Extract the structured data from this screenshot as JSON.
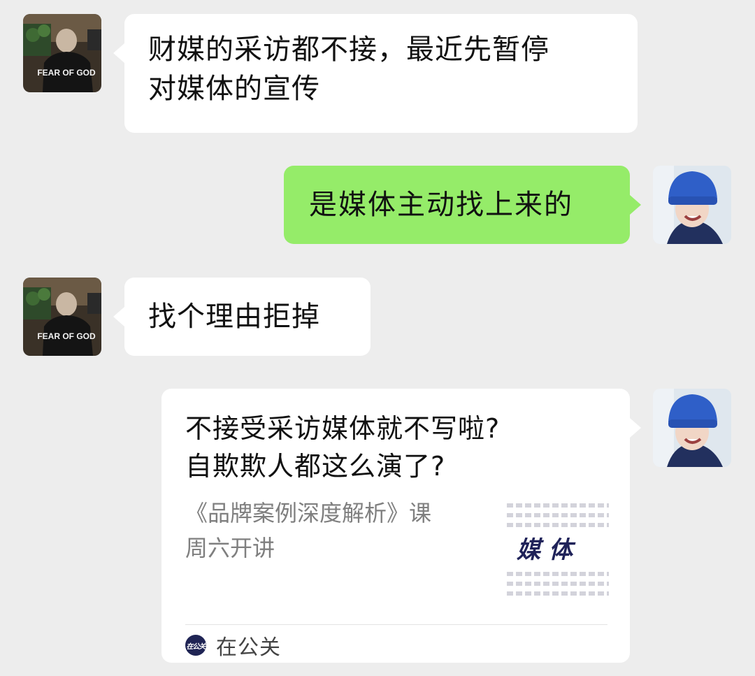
{
  "messages": [
    {
      "side": "left",
      "avatar": "avatar-fear-of-god",
      "lines": [
        "财媒的采访都不接，最近先暂停",
        "对媒体的宣传"
      ]
    },
    {
      "side": "right",
      "avatar": "avatar-blue-beanie",
      "lines": [
        "是媒体主动找上来的"
      ]
    },
    {
      "side": "left",
      "avatar": "avatar-fear-of-god",
      "lines": [
        "找个理由拒掉"
      ]
    },
    {
      "side": "right",
      "avatar": "avatar-blue-beanie",
      "type": "link-card",
      "title_lines": [
        "不接受采访媒体就不写啦?",
        "自欺欺人都这么演了?"
      ],
      "desc_lines": [
        "《品牌案例深度解析》课",
        "周六开讲"
      ],
      "thumbnail_text": "媒体",
      "source_logo_text": "在公关",
      "source_name": "在公关"
    }
  ],
  "avatar_other": {
    "shirt_text": "FEAR OF GOD"
  },
  "colors": {
    "chat_bg": "#ededed",
    "bubble_self": "#95ec69",
    "bubble_other": "#ffffff",
    "beanie_blue": "#2f5fc8",
    "thumb_text": "#1f2259"
  }
}
